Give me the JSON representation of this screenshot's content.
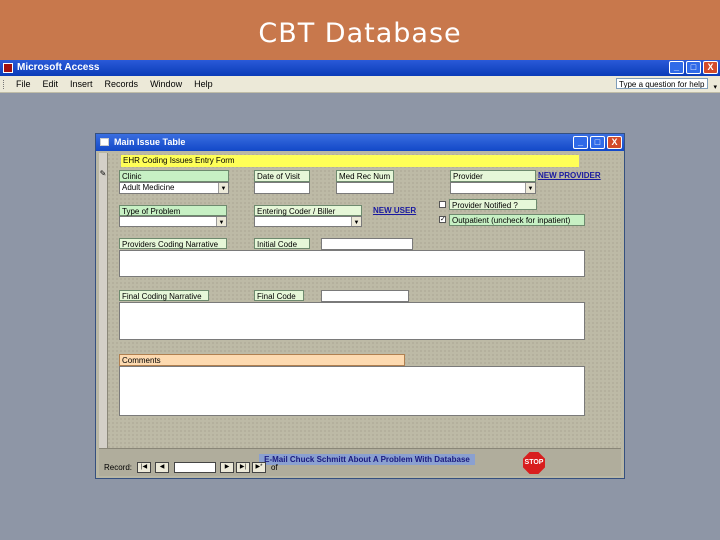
{
  "slide": {
    "title": "CBT Database"
  },
  "app": {
    "title": "Microsoft Access",
    "minimize_label": "_",
    "restore_label": "□",
    "close_label": "X"
  },
  "menu": {
    "items": [
      "File",
      "Edit",
      "Insert",
      "Records",
      "Window",
      "Help"
    ],
    "ask_placeholder": "Type a question for help",
    "ask_arrow": "▾"
  },
  "form_window": {
    "title": "Main Issue Table",
    "form_title": "EHR  Coding Issues Entry Form",
    "record_selector": "✎",
    "fields": {
      "clinic_label": "Clinic",
      "clinic_value": "Adult Medicine",
      "date_of_visit_label": "Date of Visit",
      "date_of_visit_value": "",
      "med_rec_num_label": "Med Rec Num",
      "med_rec_num_value": "",
      "provider_label": "Provider",
      "provider_value": "",
      "type_of_problem_label": "Type of Problem",
      "type_of_problem_value": "",
      "entering_coder_label": "Entering Coder / Biller",
      "entering_coder_value": "",
      "provider_notified_label": "Provider Notified ?",
      "provider_notified_checked": false,
      "outpatient_label": "Outpatient (uncheck for inpatient)",
      "outpatient_checked": true,
      "providers_narrative_label": "Providers Coding Narrative",
      "initial_code_label": "Initial Code",
      "final_narrative_label": "Final Coding Narrative",
      "final_code_label": "Final Code",
      "comments_label": "Comments"
    },
    "links": {
      "new_provider": "NEW PROVIDER",
      "new_user": "NEW USER"
    },
    "email_button": "E-Mail Chuck Schmitt About A Problem With Database",
    "stop_button": "STOP",
    "dropdown_arrow": "▼",
    "checkmark": "✓",
    "nav": {
      "record_label": "Record:",
      "first": "|◀",
      "prev": "◀",
      "next": "▶",
      "last": "▶|",
      "new": "▶*",
      "of_label": "of"
    }
  },
  "colors": {
    "green_label": "#c7f0c4",
    "yellow_header": "#ffff57",
    "orange_label": "#fddab0",
    "title_band": "#c8784c"
  }
}
